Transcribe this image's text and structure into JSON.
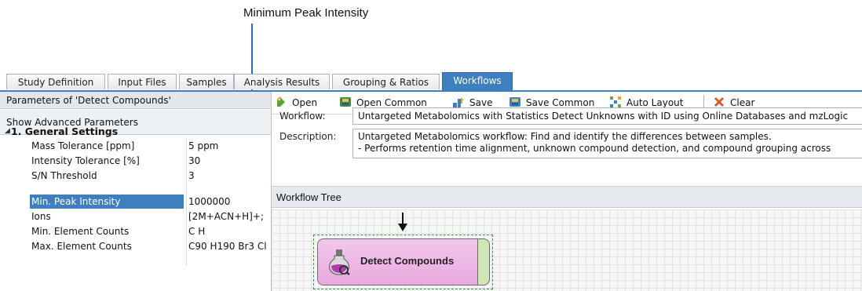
{
  "callout": {
    "text": "Minimum Peak Intensity"
  },
  "tabs": [
    "Study Definition",
    "Input Files",
    "Samples",
    "Analysis Results",
    "Grouping & Ratios",
    "Workflows"
  ],
  "active_tab": "Workflows",
  "parameters_panel": {
    "header": "Parameters of 'Detect Compounds'",
    "advanced_button": "Show Advanced Parameters",
    "group": {
      "title": "1. General Settings"
    },
    "rows": [
      {
        "name": "Mass Tolerance [ppm]",
        "value": "5 ppm"
      },
      {
        "name": "Intensity Tolerance [%]",
        "value": "30"
      },
      {
        "name": "S/N Threshold",
        "value": "3"
      },
      {
        "name": "Min. Peak Intensity",
        "value": "1000000",
        "selected": true
      },
      {
        "name": "Ions",
        "value": "[2M+ACN+H]+;"
      },
      {
        "name": "Min. Element Counts",
        "value": "C H"
      },
      {
        "name": "Max. Element Counts",
        "value": "C90 H190 Br3 Cl"
      }
    ]
  },
  "toolbar": {
    "open": "Open",
    "open_common": "Open Common",
    "save": "Save",
    "save_common": "Save Common",
    "auto_layout": "Auto Layout",
    "clear": "Clear"
  },
  "workflow": {
    "label": "Workflow:",
    "value": "Untargeted Metabolomics with Statistics Detect Unknowns with ID using Online Databases and mzLogic",
    "description_label": "Description:",
    "description_line1": "Untargeted Metabolomics workflow: Find and identify the differences between samples.",
    "description_line2": "- Performs retention time alignment, unknown compound detection, and compound grouping across"
  },
  "workflow_tree": {
    "header": "Workflow Tree",
    "node_label": "Detect Compounds"
  },
  "colors": {
    "accent": "#3e7fbf",
    "node_fill": "#e9b0e1",
    "node_tab": "#cfe6b4",
    "selection_border": "#2e9b3c"
  }
}
